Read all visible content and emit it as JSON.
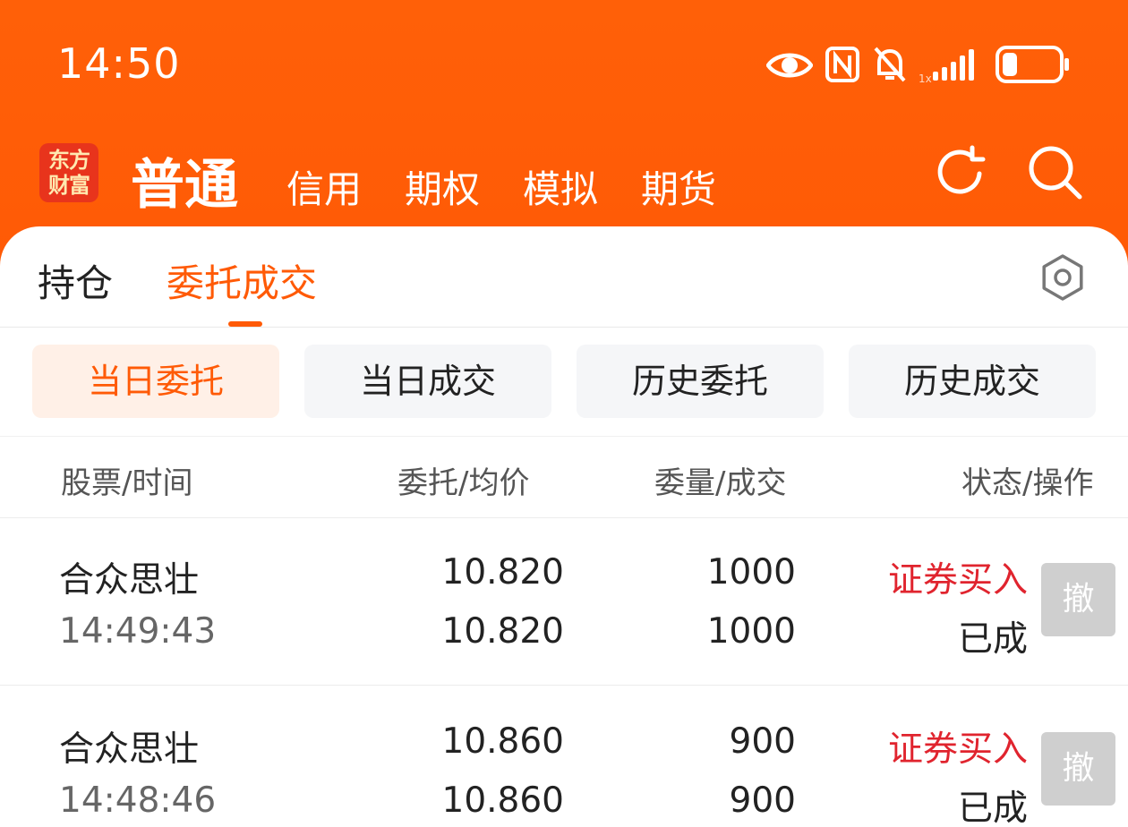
{
  "status_bar": {
    "time": "14:50",
    "icons": [
      "eye-icon",
      "nfc-icon",
      "mute-bell-icon",
      "signal-icon",
      "battery-icon"
    ]
  },
  "app": {
    "logo_line1": "东方",
    "logo_line2": "财富",
    "nav": [
      "普通",
      "信用",
      "期权",
      "模拟",
      "期货"
    ],
    "active_nav": "普通",
    "colors": {
      "accent": "#ff5a06",
      "buy": "#e0242e"
    }
  },
  "tabs": [
    "持仓",
    "委托成交"
  ],
  "active_tab": "委托成交",
  "segments": [
    "当日委托",
    "当日成交",
    "历史委托",
    "历史成交"
  ],
  "active_segment": "当日委托",
  "columns": [
    "股票/时间",
    "委托/均价",
    "委量/成交",
    "状态/操作"
  ],
  "orders": [
    {
      "stock": "合众思壮",
      "time": "14:49:43",
      "order_price": "10.820",
      "avg_price": "10.820",
      "order_qty": "1000",
      "filled_qty": "1000",
      "direction": "证券买入",
      "status": "已成",
      "action": "撤"
    },
    {
      "stock": "合众思壮",
      "time": "14:48:46",
      "order_price": "10.860",
      "avg_price": "10.860",
      "order_qty": "900",
      "filled_qty": "900",
      "direction": "证券买入",
      "status": "已成",
      "action": "撤"
    }
  ]
}
